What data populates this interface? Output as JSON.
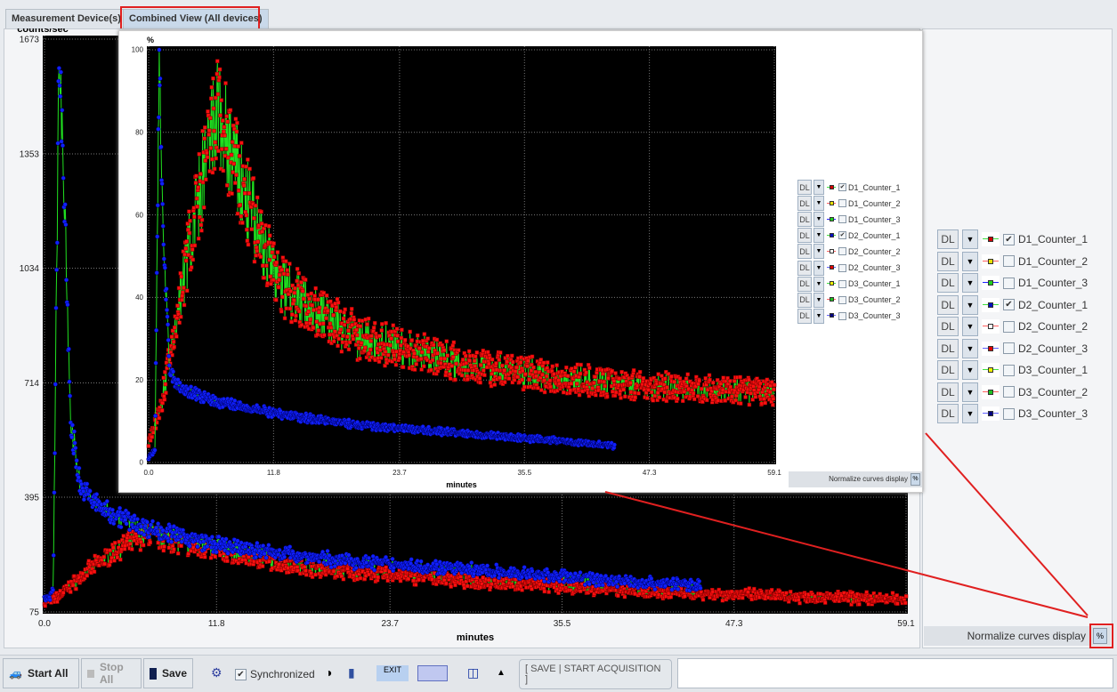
{
  "tabs": [
    {
      "label": "Measurement Device(s)"
    },
    {
      "label": "Combined View (All devices)",
      "active": true
    }
  ],
  "legend": {
    "items": [
      {
        "mode": "DL",
        "name": "D1_Counter_1",
        "checked": true,
        "marker": "#d00000",
        "line": "#40e040"
      },
      {
        "mode": "DL",
        "name": "D1_Counter_2",
        "checked": false,
        "marker": "#e8e000",
        "line": "#ff6060"
      },
      {
        "mode": "DL",
        "name": "D1_Counter_3",
        "checked": false,
        "marker": "#20d020",
        "line": "#2020ff"
      },
      {
        "mode": "DL",
        "name": "D2_Counter_1",
        "checked": true,
        "marker": "#0010c0",
        "line": "#40e040"
      },
      {
        "mode": "DL",
        "name": "D2_Counter_2",
        "checked": false,
        "marker": "#ffffff",
        "line": "#ff6060"
      },
      {
        "mode": "DL",
        "name": "D2_Counter_3",
        "checked": false,
        "marker": "#e00000",
        "line": "#6060ff"
      },
      {
        "mode": "DL",
        "name": "D3_Counter_1",
        "checked": false,
        "marker": "#f0f000",
        "line": "#40e040"
      },
      {
        "mode": "DL",
        "name": "D3_Counter_2",
        "checked": false,
        "marker": "#20c020",
        "line": "#ff6060"
      },
      {
        "mode": "DL",
        "name": "D3_Counter_3",
        "checked": false,
        "marker": "#000080",
        "line": "#6060ff"
      }
    ],
    "normalize_label": "Normalize curves display",
    "normalize_button": "%"
  },
  "toolbar": {
    "start_all": "Start All",
    "stop_all": "Stop All",
    "save": "Save",
    "synchronized": "Synchronized",
    "synchronized_checked": true,
    "save_start": "[ SAVE | START ACQUISITION ]"
  },
  "chart_data": [
    {
      "type": "scatter",
      "ylabel": "counts/sec",
      "xlabel": "minutes",
      "xlim": [
        0,
        59.1
      ],
      "ylim": [
        75,
        1673
      ],
      "xticks": [
        "0.0",
        "11.8",
        "23.7",
        "35.5",
        "47.3",
        "59.1"
      ],
      "yticks": [
        "1673",
        "1353",
        "1034",
        "714",
        "395",
        "75"
      ],
      "grid": true,
      "series": [
        {
          "name": "D1_Counter_1",
          "x": [
            0,
            1,
            3,
            5,
            7,
            10,
            15,
            20,
            30,
            40,
            50,
            59.1
          ],
          "y": [
            100,
            120,
            190,
            250,
            290,
            260,
            220,
            190,
            160,
            135,
            120,
            110
          ]
        },
        {
          "name": "D2_Counter_1",
          "x": [
            0,
            0.6,
            1,
            1.3,
            1.8,
            2.5,
            4,
            7,
            12,
            20,
            30,
            40,
            45
          ],
          "y": [
            110,
            130,
            1673,
            1300,
            600,
            420,
            360,
            310,
            260,
            220,
            190,
            160,
            150
          ]
        }
      ]
    },
    {
      "type": "scatter",
      "ylabel": "%",
      "xlabel": "minutes",
      "xlim": [
        0,
        59.1
      ],
      "ylim": [
        0,
        100
      ],
      "xticks": [
        "0.0",
        "11.8",
        "23.7",
        "35.5",
        "47.3",
        "59.1"
      ],
      "yticks": [
        "100",
        "80",
        "60",
        "40",
        "20",
        "0"
      ],
      "grid": true,
      "series": [
        {
          "name": "D1_Counter_1",
          "x": [
            0,
            1,
            2,
            4,
            6.5,
            9,
            12,
            15,
            20,
            30,
            40,
            50,
            59.1
          ],
          "y": [
            5,
            12,
            25,
            55,
            85,
            65,
            45,
            38,
            30,
            24,
            20,
            18,
            17
          ]
        },
        {
          "name": "D2_Counter_1",
          "x": [
            0,
            0.6,
            1,
            1.3,
            2,
            3,
            6,
            12,
            20,
            30,
            40,
            44
          ],
          "y": [
            1,
            3,
            100,
            60,
            22,
            18,
            15,
            12,
            9,
            7,
            5,
            4
          ]
        }
      ]
    }
  ]
}
